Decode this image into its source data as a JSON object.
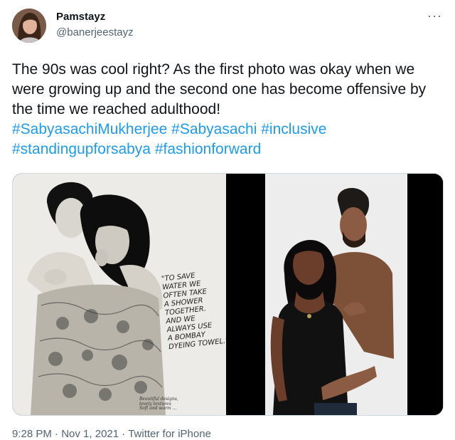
{
  "author": {
    "display_name": "Pamstayz",
    "handle": "@banerjeestayz",
    "avatar_icon": "profile-photo"
  },
  "more_icon_label": "···",
  "tweet": {
    "text": "The 90s was cool right? As the first photo was okay when we were growing up and the second one has become offensive by the time we reached adulthood!",
    "hashtags": [
      "#SabyasachiMukherjee",
      "#Sabyasachi",
      "#inclusive",
      "#standingupforsabya",
      "#fashionforward"
    ]
  },
  "media": {
    "left_photo": {
      "quote": "\"TO SAVE\nWATER WE\nOFTEN TAKE\nA SHOWER\nTOGETHER.\nAND WE\nALWAYS USE\nA BOMBAY\nDYEING TOWEL.\"",
      "fineprint": "Beautiful designs,\nlovely textures\nSoft and warm ..."
    }
  },
  "meta": {
    "time": "9:28 PM",
    "separator": "·",
    "date": "Nov 1, 2021",
    "source": "Twitter for iPhone"
  },
  "colors": {
    "link": "#1d9bf0",
    "secondary_text": "#536471",
    "primary_text": "#0f1419"
  }
}
